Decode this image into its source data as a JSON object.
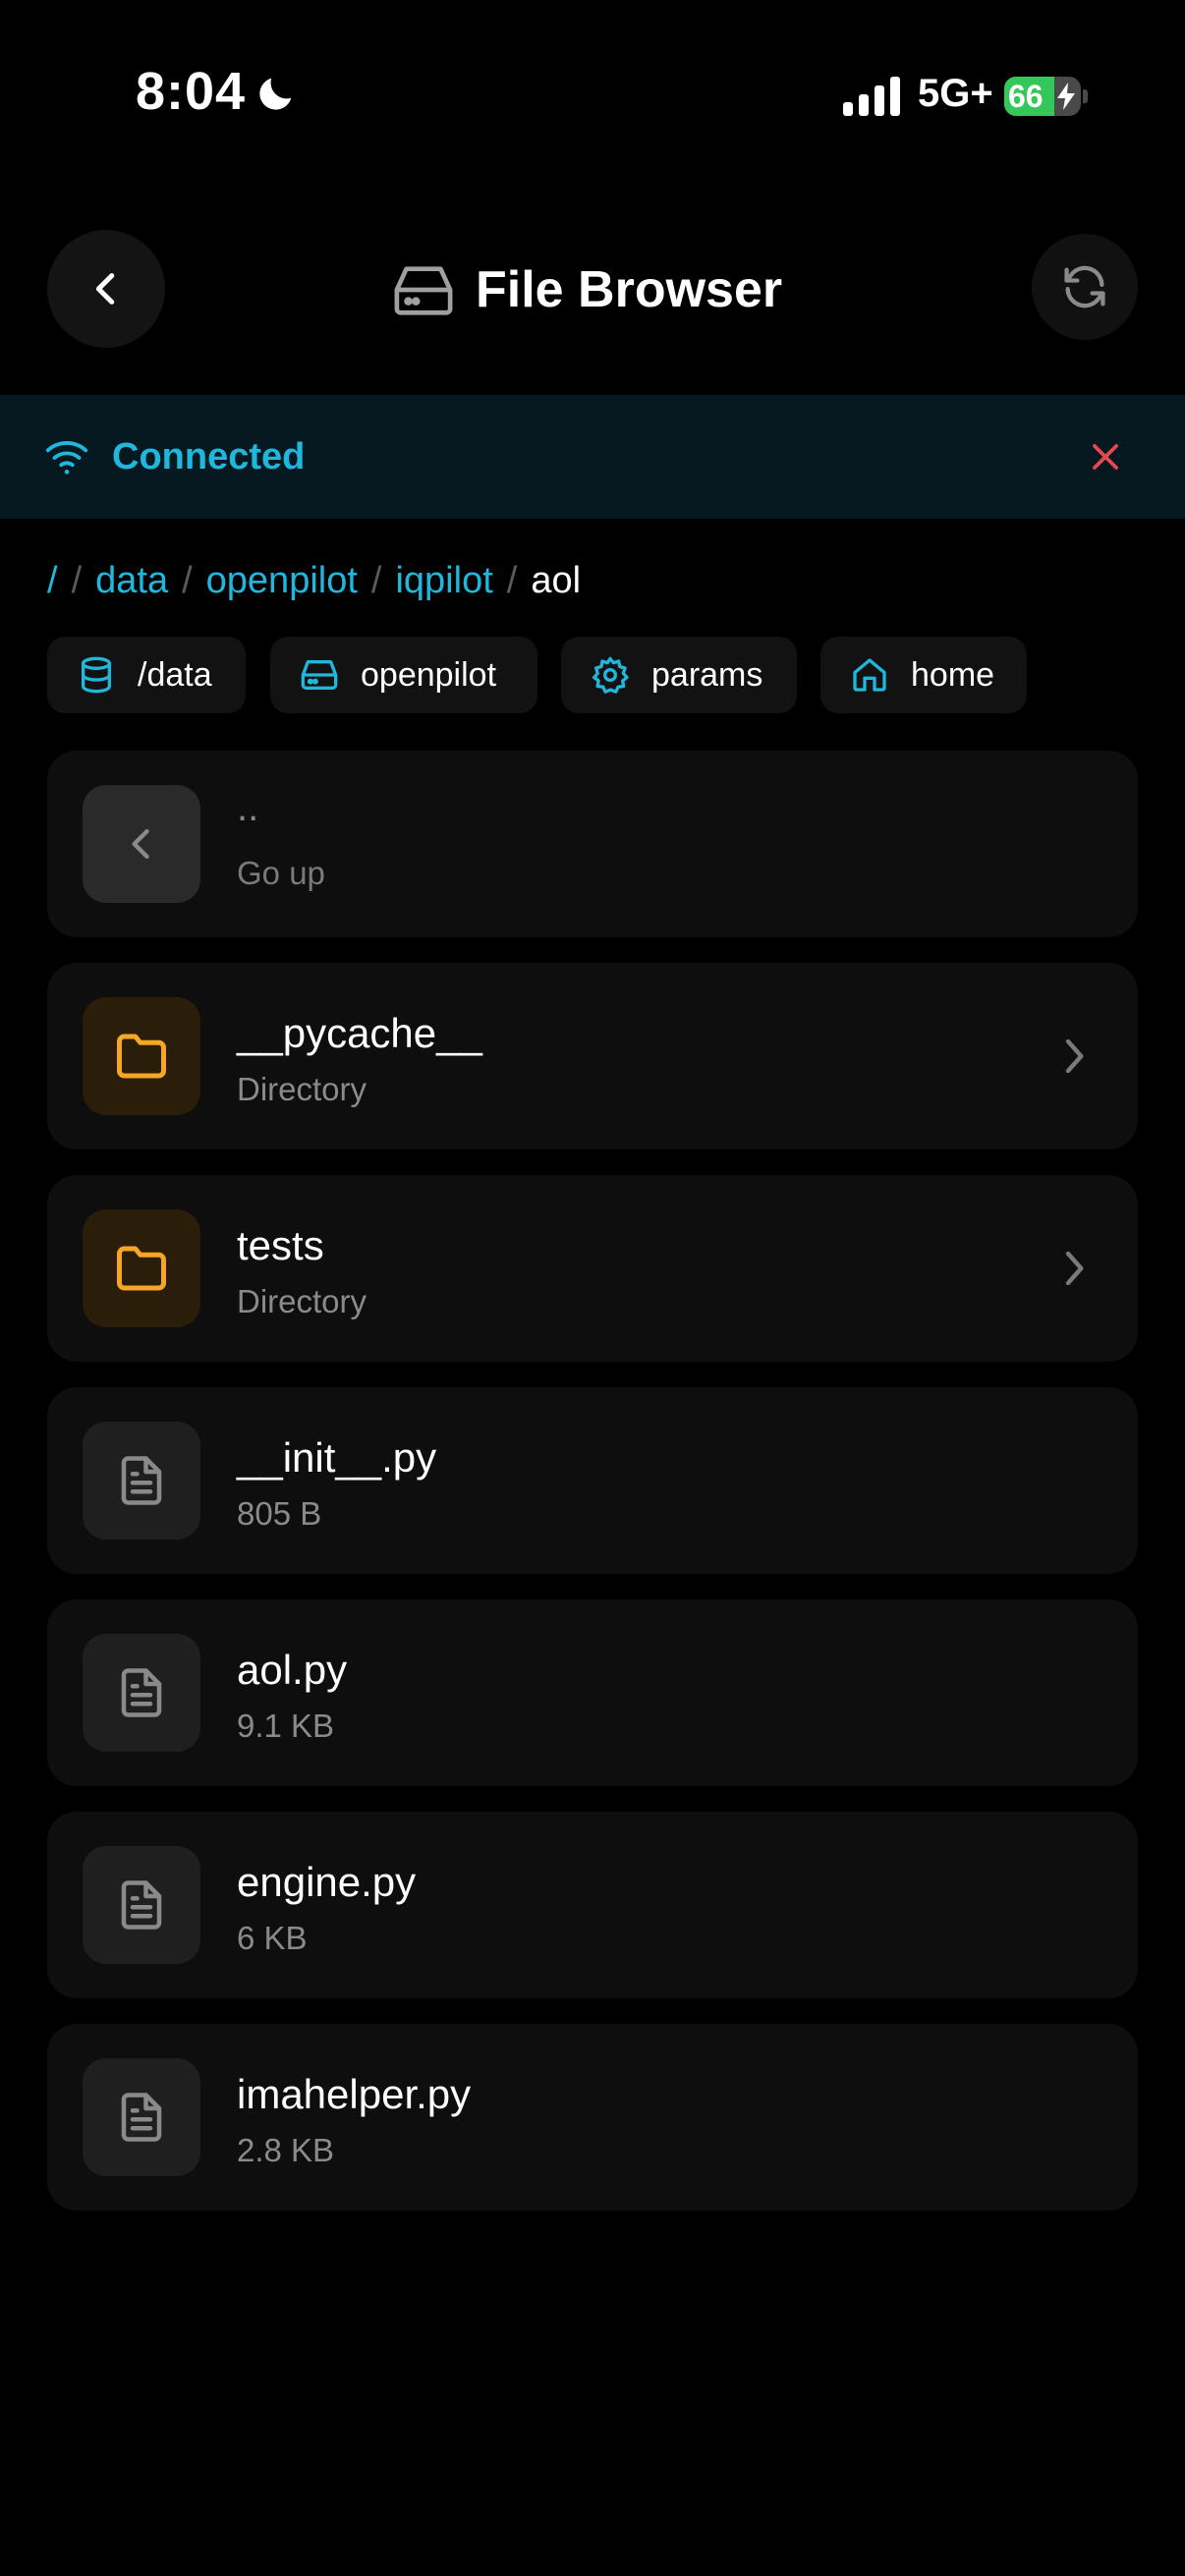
{
  "status": {
    "time": "8:04",
    "network": "5G+",
    "battery_level": 66,
    "battery_text": "66"
  },
  "header": {
    "title": "File Browser"
  },
  "banner": {
    "text": "Connected"
  },
  "breadcrumb": {
    "root": "/",
    "sep": "/",
    "links": [
      "data",
      "openpilot",
      "iqpilot"
    ],
    "current": "aol"
  },
  "quick_links": [
    {
      "label": "/data",
      "icon": "database-icon"
    },
    {
      "label": "openpilot",
      "icon": "hard-drive-icon"
    },
    {
      "label": "params",
      "icon": "gear-icon"
    },
    {
      "label": "home",
      "icon": "home-icon"
    }
  ],
  "entries": [
    {
      "name": "..",
      "sub": "Go up",
      "kind": "up"
    },
    {
      "name": "__pycache__",
      "sub": "Directory",
      "kind": "folder"
    },
    {
      "name": "tests",
      "sub": "Directory",
      "kind": "folder"
    },
    {
      "name": "__init__.py",
      "sub": "805 B",
      "kind": "file"
    },
    {
      "name": "aol.py",
      "sub": "9.1 KB",
      "kind": "file"
    },
    {
      "name": "engine.py",
      "sub": "6 KB",
      "kind": "file"
    },
    {
      "name": "imahelper.py",
      "sub": "2.8 KB",
      "kind": "file"
    }
  ],
  "colors": {
    "accent": "#1fb8dc",
    "folder": "#f5a623",
    "close": "#e5484d",
    "battery": "#34c759"
  }
}
